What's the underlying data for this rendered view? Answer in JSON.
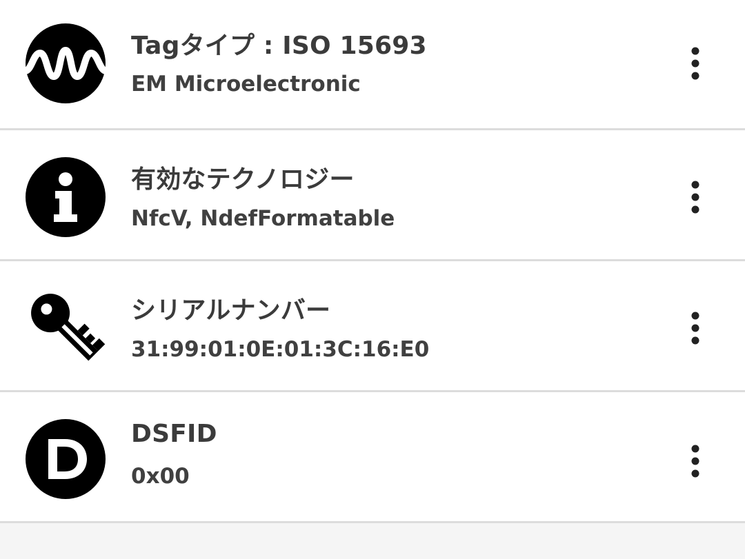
{
  "items": [
    {
      "icon": "nfc-wave-icon",
      "title": "Tagタイプ : ISO 15693",
      "subtitle": "EM Microelectronic"
    },
    {
      "icon": "info-icon",
      "title": "有効なテクノロジー",
      "subtitle": "NfcV, NdefFormatable"
    },
    {
      "icon": "key-icon",
      "title": "シリアルナンバー",
      "subtitle": "31:99:01:0E:01:3C:16:E0"
    },
    {
      "icon": "letter-d-icon",
      "title": "DSFID",
      "subtitle": "0x00"
    }
  ],
  "colors": {
    "icon": "#000000",
    "title": "#3b3b3b",
    "subtitle": "#404040",
    "divider": "#dcdcdc",
    "background": "#f5f5f5"
  }
}
